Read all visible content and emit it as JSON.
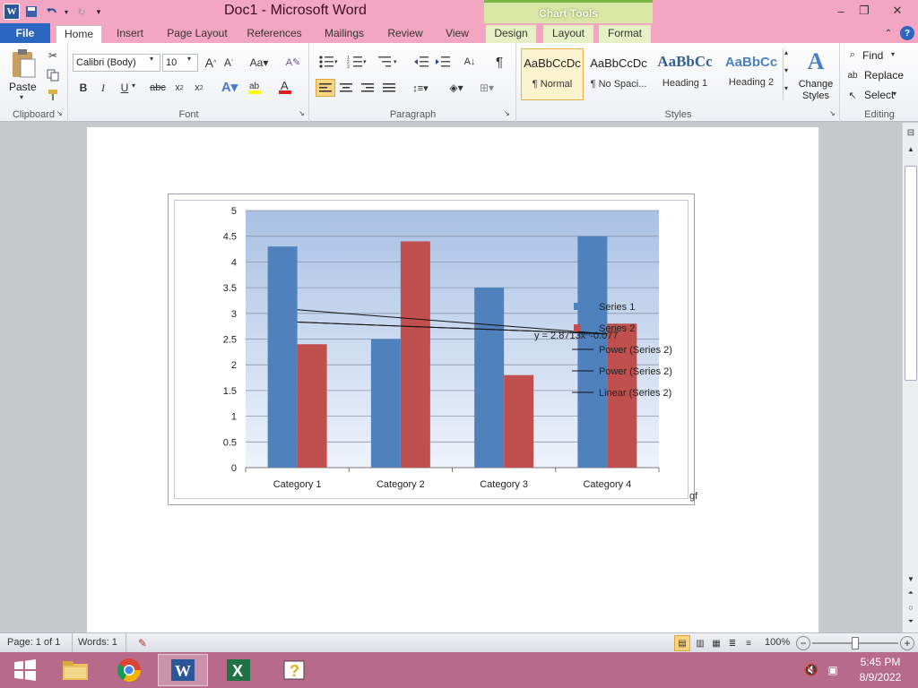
{
  "window": {
    "title": "Doc1  -  Microsoft Word",
    "contextual_tab_group": "Chart Tools"
  },
  "tabs": [
    "File",
    "Home",
    "Insert",
    "Page Layout",
    "References",
    "Mailings",
    "Review",
    "View",
    "Design",
    "Layout",
    "Format"
  ],
  "ribbon": {
    "clipboard": {
      "paste_label": "Paste",
      "group_label": "Clipboard"
    },
    "font": {
      "font_name": "Calibri (Body)",
      "font_size": "10",
      "group_label": "Font"
    },
    "paragraph": {
      "group_label": "Paragraph"
    },
    "styles": {
      "items": [
        {
          "sample": "AaBbCcDc",
          "name": "¶ Normal"
        },
        {
          "sample": "AaBbCcDc",
          "name": "¶ No Spaci..."
        },
        {
          "sample": "AaBbCc",
          "name": "Heading 1"
        },
        {
          "sample": "AaBbCc",
          "name": "Heading 2"
        }
      ],
      "change_styles": "Change Styles",
      "group_label": "Styles"
    },
    "editing": {
      "find": "Find",
      "replace": "Replace",
      "select": "Select",
      "group_label": "Editing"
    }
  },
  "chart_data": {
    "type": "bar",
    "categories": [
      "Category 1",
      "Category 2",
      "Category 3",
      "Category 4"
    ],
    "series": [
      {
        "name": "Series 1",
        "values": [
          4.3,
          2.5,
          3.5,
          4.5
        ],
        "color": "#4f81bd"
      },
      {
        "name": "Series 2",
        "values": [
          2.4,
          4.4,
          1.8,
          2.8
        ],
        "color": "#c0504d"
      }
    ],
    "trendlines": [
      {
        "name": "Power (Series 2)",
        "y_start": 3.07,
        "y_end": 2.6
      },
      {
        "name": "Power (Series 2)",
        "y_start": 2.83,
        "y_end": 2.6
      },
      {
        "name": "Linear (Series 2)",
        "y_start": 2.83,
        "y_end": 2.6
      }
    ],
    "ylim": [
      0,
      5
    ],
    "yticks": [
      "0",
      "0.5",
      "1",
      "1.5",
      "2",
      "2.5",
      "3",
      "3.5",
      "4",
      "4.5",
      "5"
    ],
    "legend_position": "right",
    "legend_entries": [
      "Series 1",
      "Series 2",
      "Power (Series 2)",
      "Power (Series 2)",
      "Linear (Series 2)"
    ],
    "equation_text": "y = 2.8713x^-0.077",
    "plot_background": "#a9c1e4",
    "grid": true
  },
  "status": {
    "page": "Page: 1 of 1",
    "words": "Words: 1",
    "zoom": "100%"
  },
  "taskbar": {
    "time": "5:45 PM",
    "date": "8/9/2022"
  },
  "colors": {
    "titlebar": "#f3a6c1",
    "file_tab": "#2b66c0",
    "taskbar": "#b76a89"
  }
}
